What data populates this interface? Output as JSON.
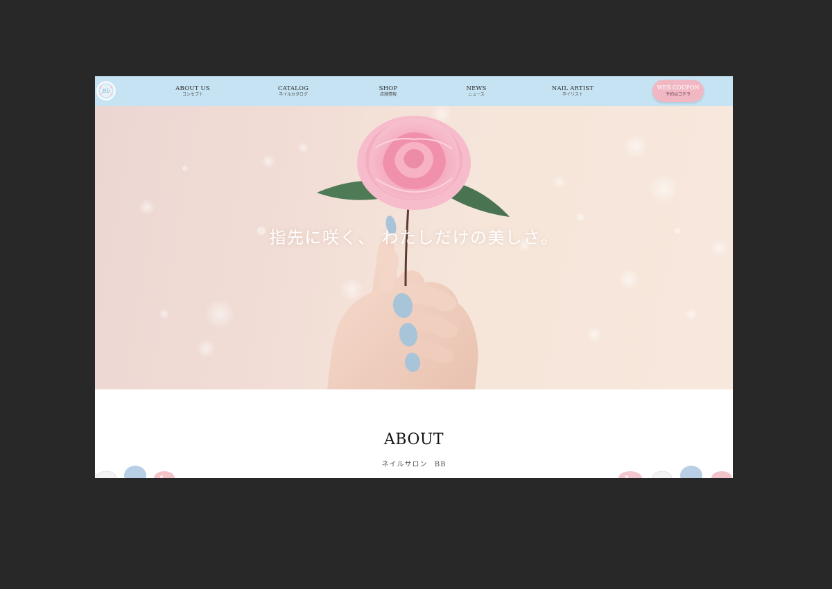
{
  "nav": {
    "logo_icon": "salon-logo-icon",
    "items": [
      {
        "en": "ABOUT US",
        "ja": "コンセプト"
      },
      {
        "en": "CATALOG",
        "ja": "ネイルカタログ"
      },
      {
        "en": "SHOP",
        "ja": "店舗情報"
      },
      {
        "en": "NEWS",
        "ja": "ニュース"
      },
      {
        "en": "NAIL ARTIST",
        "ja": "ネイリスト"
      }
    ],
    "coupon": {
      "en": "WEB COUPON",
      "ja": "予約はコチラ"
    }
  },
  "hero": {
    "caption": "指先に咲く、 わたしだけの美しさ。",
    "image_icons": [
      "camellia-flower-icon",
      "hand-icon"
    ]
  },
  "about": {
    "title": "ABOUT",
    "subtitle": "ネイルサロン BB"
  },
  "colors": {
    "navbar": "#c6e3f3",
    "coupon": "#f1b8c3",
    "nail": "#a8c4d8",
    "flower": "#f2a7bb",
    "outer_bg": "#282828"
  }
}
